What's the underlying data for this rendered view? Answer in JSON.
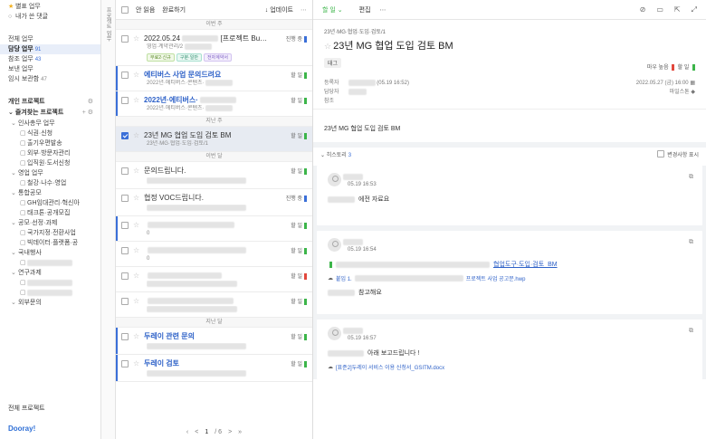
{
  "sidebar": {
    "top": [
      {
        "icon": "star-icon",
        "label": "별표 업무"
      },
      {
        "icon": "comment-icon",
        "label": "내가 쓴 댓글"
      }
    ],
    "views": [
      {
        "label": "전체 업무",
        "count": ""
      },
      {
        "label": "담당 업무",
        "count": "91",
        "active": true
      },
      {
        "label": "참조 업무",
        "count": "43"
      },
      {
        "label": "보낸 업무",
        "count": ""
      },
      {
        "label": "임시 보관함",
        "count": "47"
      }
    ],
    "personal_projects": "개인 프로젝트",
    "favorite_projects": "즐겨찾는 프로젝트",
    "tree": [
      {
        "level": 1,
        "label": "인사총무 업무"
      },
      {
        "level": 2,
        "label": "식권·신청"
      },
      {
        "level": 2,
        "label": "출기우편발송"
      },
      {
        "level": 2,
        "label": "외부·방문자관리"
      },
      {
        "level": 2,
        "label": "입직원·도서신청"
      },
      {
        "level": 1,
        "label": "영업 업무"
      },
      {
        "level": 2,
        "label": "철강·나수·영업"
      },
      {
        "level": 1,
        "label": "통합공모"
      },
      {
        "level": 2,
        "label": "GH임대관리·혁신아"
      },
      {
        "level": 2,
        "label": "태크톤·공개모집"
      },
      {
        "level": 1,
        "label": "공모·선정·과제"
      },
      {
        "level": 2,
        "label": "국가지정·전환사업"
      },
      {
        "level": 2,
        "label": "빅데이터·플랫폼·공"
      },
      {
        "level": 1,
        "label": "국내행사"
      },
      {
        "level": 2,
        "label": ""
      },
      {
        "level": 1,
        "label": "연구과제"
      },
      {
        "level": 2,
        "label": ""
      },
      {
        "level": 2,
        "label": ""
      },
      {
        "level": 1,
        "label": "외부문의"
      }
    ],
    "all_projects": "전체 프로젝트",
    "brand": "Dooray!"
  },
  "strip_label": "프로젝트 업무",
  "list": {
    "toolbar": {
      "unread": "안 읽음",
      "done": "완료하기",
      "update": "업데이트",
      "more": "⋯"
    },
    "groups": [
      {
        "label": "이번 주",
        "items": [
          {
            "title": "2022.05.24",
            "title2": "[프로젝트 Bu…",
            "sub": "영업·계약관리/2",
            "status": "진행 중",
            "color": "b",
            "chips": [
              "무료2·신규",
              "구분·일반",
              "전자계약서"
            ],
            "link": false,
            "bar": false
          },
          {
            "title": "에티버스 사업 문의드려요",
            "sub": "2022년·에티버스·콘텐츠·",
            "status": "할 일",
            "color": "g",
            "link": true,
            "bar": true
          },
          {
            "title": "2022년·에티버스·",
            "sub": "2022년·에티버스·콘텐츠·",
            "status": "할 일",
            "color": "g",
            "link": true,
            "bar": true
          }
        ]
      },
      {
        "label": "지난 주",
        "items": [
          {
            "title": "23년 MG 협업 도입 검토 BM",
            "sub": "23년·MG·협업·도입·검토/1",
            "status": "할 일",
            "color": "g",
            "link": false,
            "bar": false,
            "selected": true
          }
        ]
      },
      {
        "label": "이번 달",
        "items": [
          {
            "title": "문의드립니다.",
            "sub": "",
            "status": "할 일",
            "color": "g",
            "link": false,
            "bar": false
          },
          {
            "title": "협정 VOC드립니다.",
            "sub": "",
            "status": "진행 중",
            "color": "b",
            "link": false,
            "bar": false
          },
          {
            "title": "",
            "sub": "0",
            "status": "할 일",
            "color": "g",
            "link": false,
            "bar": true
          },
          {
            "title": "",
            "sub": "0",
            "status": "할 일",
            "color": "g",
            "link": false,
            "bar": false
          },
          {
            "title": "",
            "sub": "",
            "status": "할 일",
            "color": "r",
            "link": false,
            "bar": false
          },
          {
            "title": "",
            "sub": "",
            "status": "할 일",
            "color": "g",
            "link": false,
            "bar": false
          }
        ]
      },
      {
        "label": "지난 달",
        "items": [
          {
            "title": "두레이 관련 문의",
            "sub": "",
            "status": "할 일",
            "color": "g",
            "link": true,
            "bar": true
          },
          {
            "title": "두레이 검토",
            "sub": "",
            "status": "할 일",
            "color": "g",
            "link": true,
            "bar": true
          }
        ]
      }
    ],
    "pager": {
      "first": "‹",
      "prev": "<",
      "current": "1",
      "total": "/ 6",
      "next": ">",
      "last": "»"
    }
  },
  "detail": {
    "toolbar": {
      "status": "할 일",
      "edit": "편집",
      "more": "⋯"
    },
    "breadcrumb": "23년·MG·협업·도입·검토/1",
    "title": "23년 MG 협업 도입 검토 BM",
    "priority_label": "마우 높음",
    "priority_status": "할 일",
    "tag": "태그",
    "meta": {
      "author_label": "등록자",
      "author_date": "(05.19 16:52)",
      "assignee_label": "담당자",
      "cc_label": "참조",
      "due": "2022.05.27 (금) 16:00",
      "milestone": "마일스톤"
    },
    "body": "23년 MG 협업 도입 검토 BM",
    "history": {
      "label": "히스토리",
      "count": "3",
      "change_label": "변경사항 표시"
    },
    "comments": [
      {
        "time": "05.19 16:53",
        "text": "에전 자료요",
        "link": "",
        "file": ""
      },
      {
        "time": "05.19 16:54",
        "text": "참고해요",
        "link": "협업도구·도입·검토_BM",
        "file": "프로젝트 사업 공고문.hwp",
        "file_prefix": "붙임 1."
      },
      {
        "time": "05.19 16:57",
        "text": "아래 보고드립니다 !",
        "link": "",
        "file": "[표준2]두레이 서비스 이용 신청서_GSITM.docx"
      }
    ]
  }
}
